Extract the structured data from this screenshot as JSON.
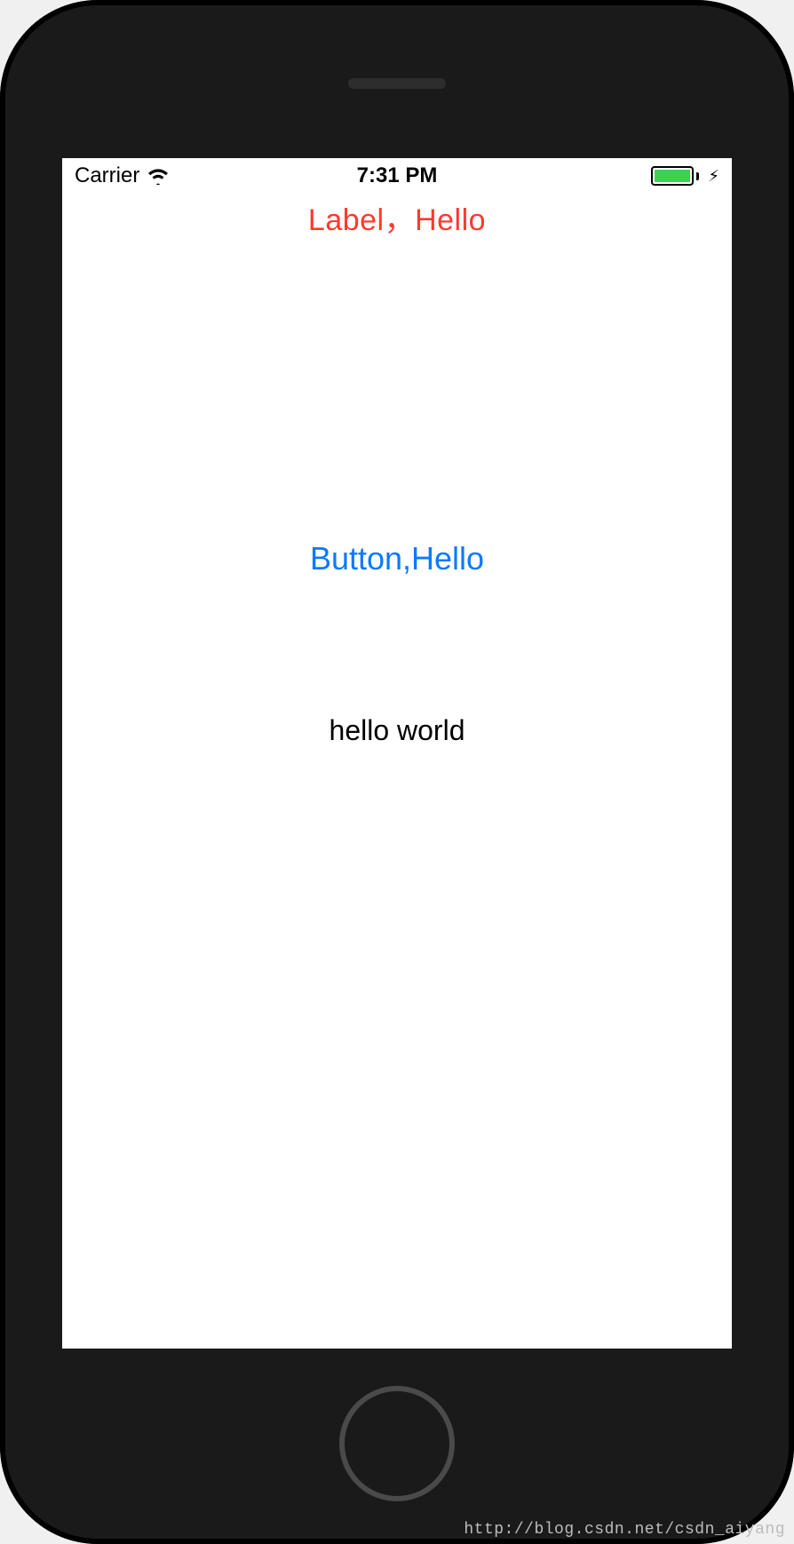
{
  "status_bar": {
    "carrier": "Carrier",
    "time": "7:31 PM"
  },
  "content": {
    "title_label": "Label，Hello",
    "button_label": "Button,Hello",
    "hello_label": "hello world"
  },
  "watermark": "http://blog.csdn.net/csdn_aiyang",
  "colors": {
    "label_red": "#ff3a2f",
    "button_blue": "#0a7aff",
    "battery_green": "#39d353"
  }
}
